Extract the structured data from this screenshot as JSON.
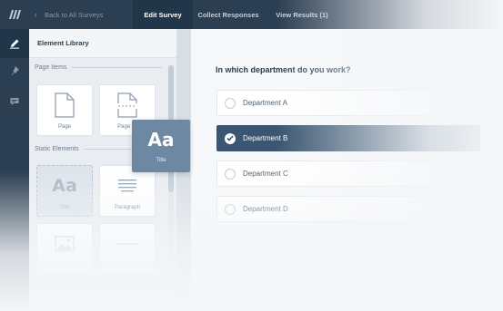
{
  "topbar": {
    "back_label": "Back to All Surveys",
    "tabs": [
      {
        "label": "Edit Survey",
        "active": true
      },
      {
        "label": "Collect Responses",
        "active": false
      },
      {
        "label": "View Results (1)",
        "active": false
      }
    ]
  },
  "rail": {
    "items": [
      {
        "icon": "pencil-icon",
        "active": true
      },
      {
        "icon": "pin-icon",
        "active": false
      },
      {
        "icon": "chat-icon",
        "active": false
      }
    ]
  },
  "library": {
    "title": "Element Library",
    "sections": [
      {
        "label": "Page Items"
      },
      {
        "label": "Static Elements"
      }
    ],
    "page_items": [
      {
        "label": "Page",
        "icon": "page-icon"
      },
      {
        "label": "Page Br",
        "icon": "page-break-icon"
      }
    ],
    "static_elements": [
      {
        "label": "Title",
        "icon": "title-icon",
        "glyph": "Aa"
      },
      {
        "label": "Paragraph",
        "icon": "paragraph-icon"
      },
      {
        "label": "",
        "icon": "image-icon"
      },
      {
        "label": "",
        "icon": "divider-icon"
      }
    ]
  },
  "drag_tile": {
    "glyph": "Aa",
    "label": "Title"
  },
  "question": {
    "text": "In which department do you work?",
    "options": [
      {
        "label": "Department A",
        "selected": false
      },
      {
        "label": "Department B",
        "selected": true
      },
      {
        "label": "Department C",
        "selected": false
      },
      {
        "label": "Department D",
        "selected": false
      }
    ]
  },
  "colors": {
    "nav_bg": "#2b3e52",
    "nav_active": "#22364a",
    "selected_option": "#3b5670",
    "drag_tile": "#6c88a2"
  }
}
